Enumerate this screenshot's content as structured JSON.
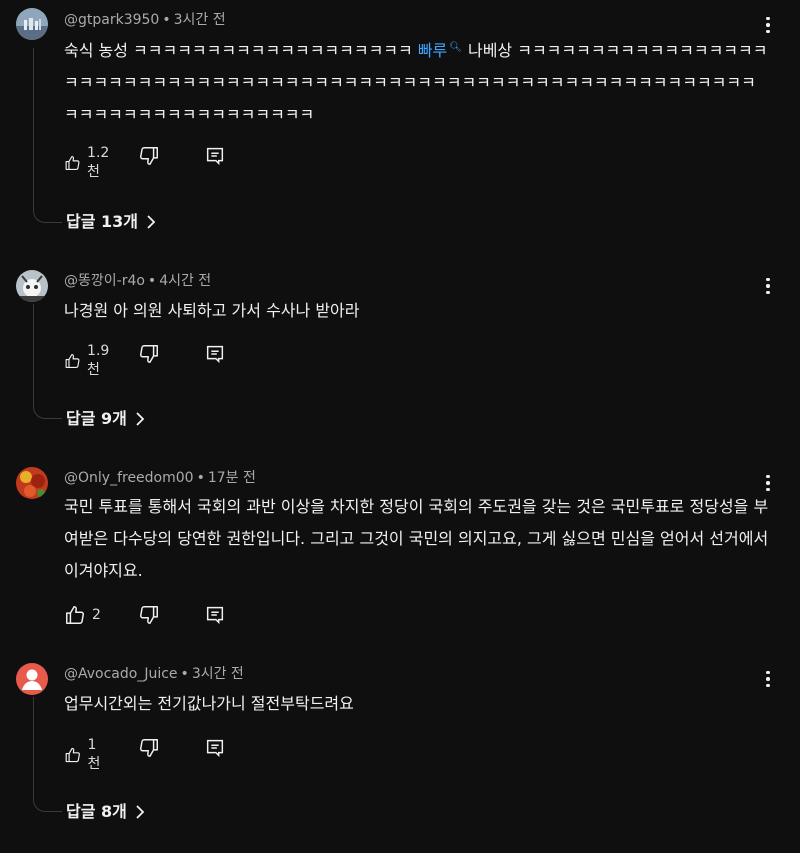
{
  "comments": [
    {
      "author": "@gtpark3950",
      "time": "3시간 전",
      "text_before": "숙식 농성 ㅋㅋㅋㅋㅋㅋㅋㅋㅋㅋㅋㅋㅋㅋㅋㅋㅋㅋㅋ ",
      "link": "빠루",
      "text_after": "나베상 ㅋㅋㅋㅋㅋㅋㅋㅋㅋㅋㅋㅋㅋㅋㅋㅋㅋㅋㅋㅋㅋㅋㅋㅋㅋㅋㅋㅋㅋㅋㅋㅋㅋㅋㅋㅋㅋㅋㅋㅋㅋㅋㅋㅋㅋㅋㅋㅋㅋㅋㅋㅋㅋㅋㅋㅋㅋㅋㅋㅋㅋㅋㅋㅋㅋㅋㅋㅋㅋㅋㅋㅋㅋㅋㅋㅋㅋㅋㅋㅋㅋ",
      "likes": "1.2천",
      "replies": "답글 13개"
    },
    {
      "author": "@똥깡이-r4o",
      "time": "4시간 전",
      "text": "나경원 아 의원 사퇴하고 가서 수사나 받아라",
      "likes": "1.9천",
      "replies": "답글 9개"
    },
    {
      "author": "@Only_freedom00",
      "time": "17분 전",
      "text": "국민 투표를 통해서 국회의 과반 이상을 차지한 정당이 국회의 주도권을 갖는 것은 국민투표로 정당성을 부여받은 다수당의 당연한 권한입니다. 그리고 그것이 국민의 의지고요, 그게 싫으면 민심을 얻어서 선거에서 이겨야지요.",
      "likes": "2"
    },
    {
      "author": "@Avocado_Juice",
      "time": "3시간 전",
      "text": "업무시간외는 전기값나가니 절전부탁드려요",
      "likes": "1천",
      "replies": "답글 8개"
    }
  ],
  "colors": {
    "background": "#0f0f0f",
    "link": "#3ea6ff",
    "secondary": "#aaaaaa"
  },
  "icons": [
    "more-vert-icon",
    "thumb-up-icon",
    "thumb-down-icon",
    "reply-icon",
    "chevron-right-icon"
  ]
}
